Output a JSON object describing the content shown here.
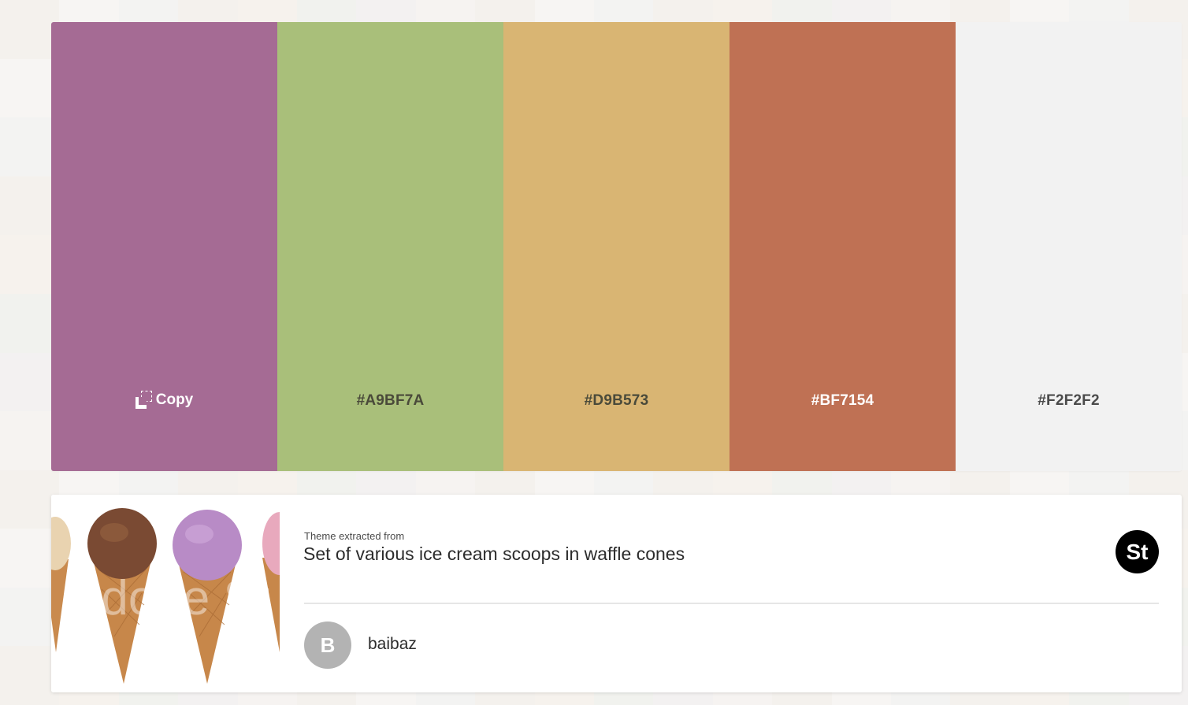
{
  "palette": {
    "swatches": [
      {
        "color": "#A56B94",
        "label": "Copy",
        "text_color": "#FFFFFF"
      },
      {
        "color": "#A9BF7A",
        "label": "#A9BF7A",
        "text_color": "#4A4A3A"
      },
      {
        "color": "#D9B573",
        "label": "#D9B573",
        "text_color": "#4A4A3A"
      },
      {
        "color": "#BF7154",
        "label": "#BF7154",
        "text_color": "#FFFFFF"
      },
      {
        "color": "#F2F2F2",
        "label": "#F2F2F2",
        "text_color": "#4B4B4B"
      }
    ]
  },
  "source": {
    "label": "Theme extracted from",
    "title": "Set of various ice cream scoops in waffle cones",
    "badge": "St",
    "watermark": "Adobe St"
  },
  "author": {
    "initial": "B",
    "name": "baibaz"
  }
}
